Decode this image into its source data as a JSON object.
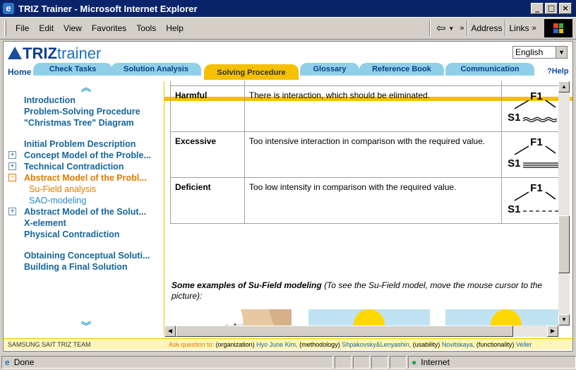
{
  "window": {
    "title": "TRIZ Trainer - Microsoft Internet Explorer",
    "buttons": [
      "_",
      "□",
      "×"
    ]
  },
  "menu": {
    "items": [
      "File",
      "Edit",
      "View",
      "Favorites",
      "Tools",
      "Help"
    ],
    "address_label": "Address",
    "links_label": "Links",
    "chevron": "»"
  },
  "app": {
    "logo_tri": "TRIZ",
    "logo_trainer": "trainer",
    "language": "English",
    "home": "Home",
    "help": "?Help",
    "tabs": [
      "Check Tasks",
      "Solution Analysis",
      "Solving Procedure",
      "Glossary",
      "Reference Book",
      "Communication"
    ],
    "active_tab": "Solving Procedure"
  },
  "nav": {
    "items": [
      {
        "label": "Introduction"
      },
      {
        "label": "Problem-Solving Procedure"
      },
      {
        "label": "\"Christmas Tree\" Diagram"
      },
      {
        "label": "Initial Problem Description"
      },
      {
        "label": "Concept Model of the Proble..."
      },
      {
        "label": "Technical Contradiction"
      },
      {
        "label": "Abstract Model of the Probl..."
      },
      {
        "label": "Su-Field analysis"
      },
      {
        "label": "SAO-modeling"
      },
      {
        "label": "Abstract Model of the Solut..."
      },
      {
        "label": "X-element"
      },
      {
        "label": "Physical Contradiction"
      },
      {
        "label": "Obtaining Conceptual Soluti..."
      },
      {
        "label": "Building a Final Solution"
      }
    ]
  },
  "table": {
    "rows": [
      {
        "name": "Harmful",
        "desc": "There is interaction, which should be eliminated.",
        "f": "F1",
        "s": "S1"
      },
      {
        "name": "Excessive",
        "desc": "Too intensive interaction in comparison with the required value.",
        "f": "F1",
        "s": "S1"
      },
      {
        "name": "Deficient",
        "desc": "Too low intensity in comparison with the required value.",
        "f": "F1",
        "s": "S1"
      }
    ]
  },
  "examples": {
    "heading": "Some examples of Su-Field modeling",
    "note": "(To see the Su-Field model, move the mouse cursor to the picture):"
  },
  "footer": {
    "team": "SAMSUNG SAIT TRIZ TEAM",
    "ask": "Ask question to:",
    "org_lbl": "(organization)",
    "org_nm": "Hyo June Kim,",
    "meth_lbl": "(methodology)",
    "meth_nm": "Shpakovsky&Lenyashin,",
    "use_lbl": "(usability)",
    "use_nm": "Novitskaya,",
    "fun_lbl": "(functionality)",
    "fun_nm": "Veller"
  },
  "status": {
    "text": "Done",
    "zone": "Internet"
  }
}
